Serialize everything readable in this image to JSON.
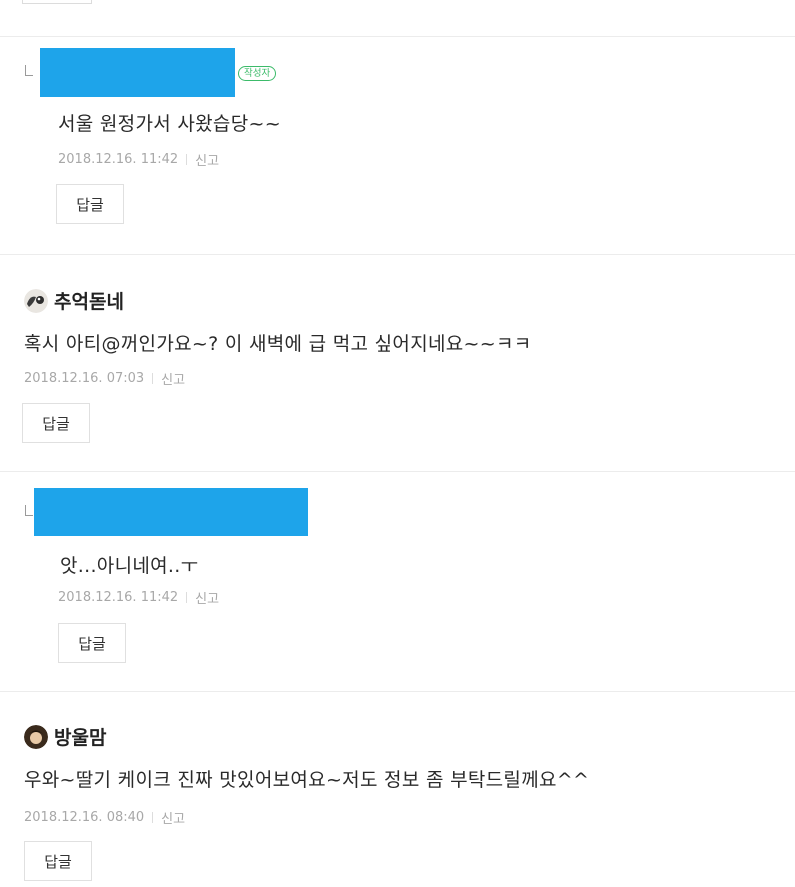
{
  "author_badge": "작성자",
  "comments": [
    {
      "type": "reply",
      "author": "",
      "is_author": true,
      "text": "서울 원정가서 사왔습당~~",
      "date": "2018.12.16. 11:42",
      "report": "신고",
      "reply_label": "답글"
    },
    {
      "type": "comment",
      "author": "추억돋네",
      "text": "혹시 아티@꺼인가요~? 이 새벽에 급 먹고 싶어지네요~~ㅋㅋ",
      "date": "2018.12.16. 07:03",
      "report": "신고",
      "reply_label": "답글"
    },
    {
      "type": "reply",
      "author": "",
      "is_author": false,
      "text": "앗...아니네여..ㅜ",
      "date": "2018.12.16. 11:42",
      "report": "신고",
      "reply_label": "답글"
    },
    {
      "type": "comment",
      "author": "방울맘",
      "text": "우와~딸기 케이크 진짜 맛있어보여요~저도 정보 좀 부탁드릴께요^^",
      "date": "2018.12.16. 08:40",
      "report": "신고",
      "reply_label": "답글"
    }
  ],
  "colors": {
    "redaction": "#1ea4ea",
    "author_badge": "#3cbb6a",
    "meta_text": "#a8a8a8"
  }
}
